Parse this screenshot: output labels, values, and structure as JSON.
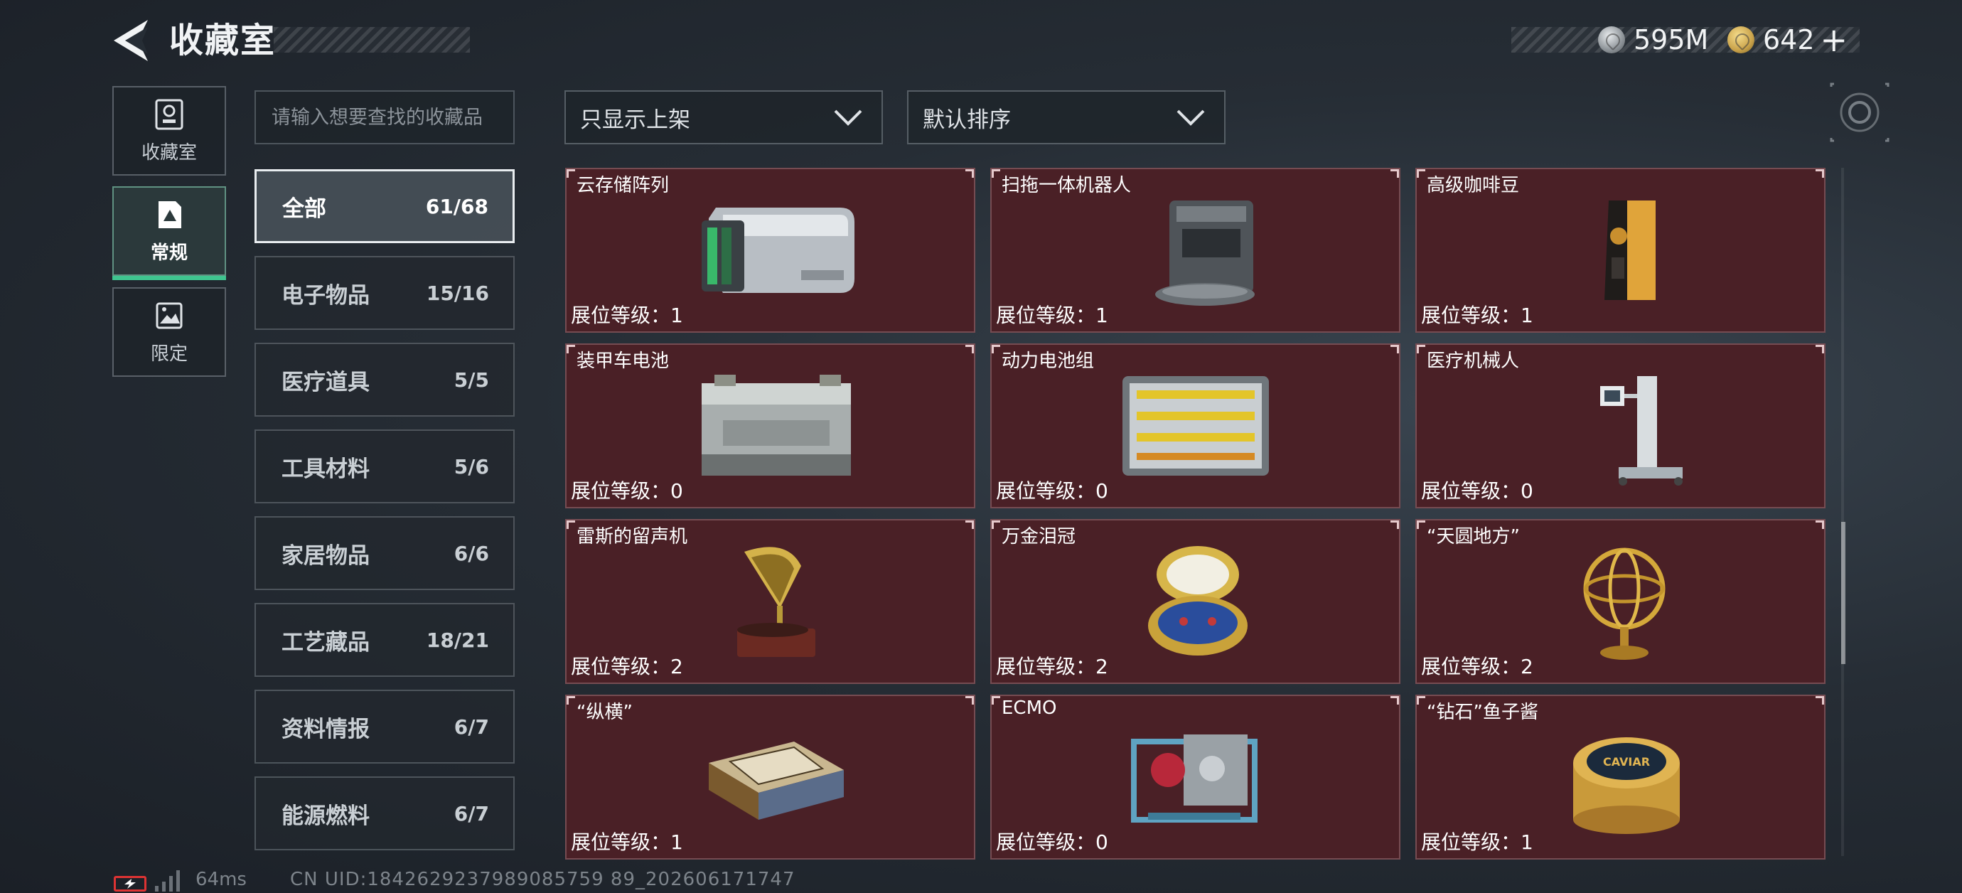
{
  "header": {
    "title": "收藏室",
    "currencies": [
      {
        "icon": "silver-coin-icon",
        "value": "595M"
      },
      {
        "icon": "gold-coin-icon",
        "value": "642",
        "plus": "+"
      }
    ]
  },
  "nav": [
    {
      "label": "收藏室",
      "icon": "trophy-icon",
      "active": false
    },
    {
      "label": "常规",
      "icon": "document-icon",
      "active": true
    },
    {
      "label": "限定",
      "icon": "image-icon",
      "active": false
    }
  ],
  "search": {
    "placeholder": "请输入想要查找的收藏品",
    "value": ""
  },
  "filters": {
    "shelf_filter": "只显示上架",
    "sort": "默认排序"
  },
  "categories": [
    {
      "name": "全部",
      "count": "61/68",
      "active": true
    },
    {
      "name": "电子物品",
      "count": "15/16"
    },
    {
      "name": "医疗道具",
      "count": "5/5"
    },
    {
      "name": "工具材料",
      "count": "5/6"
    },
    {
      "name": "家居物品",
      "count": "6/6"
    },
    {
      "name": "工艺藏品",
      "count": "18/21"
    },
    {
      "name": "资料情报",
      "count": "6/7"
    },
    {
      "name": "能源燃料",
      "count": "6/7"
    }
  ],
  "items": [
    {
      "name": "云存储阵列",
      "level": "展位等级：1",
      "icon": "server-array-icon"
    },
    {
      "name": "扫拖一体机器人",
      "level": "展位等级：1",
      "icon": "robot-vacuum-icon"
    },
    {
      "name": "高级咖啡豆",
      "level": "展位等级：1",
      "icon": "coffee-bag-icon"
    },
    {
      "name": "装甲车电池",
      "level": "展位等级：0",
      "icon": "vehicle-battery-icon"
    },
    {
      "name": "动力电池组",
      "level": "展位等级：0",
      "icon": "battery-pack-icon"
    },
    {
      "name": "医疗机械人",
      "level": "展位等级：0",
      "icon": "medical-robot-icon"
    },
    {
      "name": "雷斯的留声机",
      "level": "展位等级：2",
      "icon": "gramophone-icon"
    },
    {
      "name": "万金泪冠",
      "level": "展位等级：2",
      "icon": "jeweled-egg-icon"
    },
    {
      "name": "“天圆地方”",
      "level": "展位等级：2",
      "icon": "armillary-sphere-icon"
    },
    {
      "name": "“纵横”",
      "level": "展位等级：1",
      "icon": "chess-box-icon"
    },
    {
      "name": "ECMO",
      "level": "展位等级：0",
      "icon": "ecmo-machine-icon"
    },
    {
      "name": "“钻石”鱼子酱",
      "level": "展位等级：1",
      "icon": "caviar-tin-icon",
      "tin_label": "CAVIAR"
    }
  ],
  "footer": {
    "ping": "64ms",
    "uid": "CN UID:1842629237989085759 89_202606171747"
  },
  "colors": {
    "card_bg": "#4a2026",
    "accent_green": "#3fc58f",
    "background": "#262d35"
  }
}
